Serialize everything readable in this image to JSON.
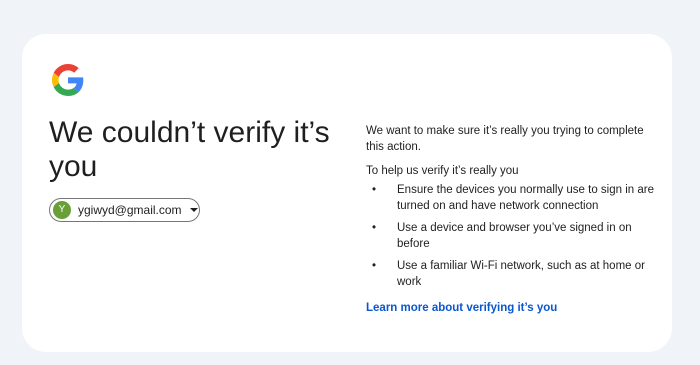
{
  "heading": "We couldn’t verify it’s you",
  "account": {
    "avatar_initial": "Y",
    "email": "ygiwyd@gmail.com"
  },
  "intro": "We want to make sure it’s really you trying to complete this action.",
  "help_heading": "To help us verify it’s really you",
  "tips": [
    "Ensure the devices you normally use to sign in are turned on and have network connection",
    "Use a device and browser you’ve signed in on before",
    "Use a familiar Wi-Fi network, such as at home or work"
  ],
  "learn_more_label": "Learn more about verifying it’s you",
  "icons": {
    "logo": "google-logo-icon",
    "account_menu": "caret-down-icon"
  },
  "colors": {
    "background": "#f0f4f9",
    "card": "#ffffff",
    "link": "#0b57d0",
    "avatar": "#689f38"
  }
}
